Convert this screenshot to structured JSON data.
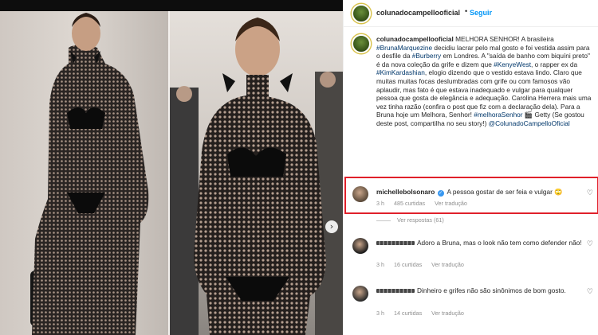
{
  "post": {
    "username": "colunadocampellooficial",
    "follow_label": "Seguir",
    "separator": "•"
  },
  "caption": {
    "username": "colunadocampellooficial",
    "segments": [
      {
        "t": "MELHORA SENHOR! A brasileira "
      },
      {
        "t": "#BrunaMarquezine",
        "tag": true
      },
      {
        "t": " decidiu lacrar pelo mal gosto e foi vestida assim para o desfile da "
      },
      {
        "t": "#Burberry",
        "tag": true
      },
      {
        "t": " em Londres. A \"saída de banho com biquíni preto\" é da nova coleção da grife e dizem que "
      },
      {
        "t": "#KenyeWest",
        "tag": true
      },
      {
        "t": ", o rapper ex da "
      },
      {
        "t": "#KimKardashian",
        "tag": true
      },
      {
        "t": ", elogio dizendo que o vestido estava lindo. Claro que muitas muitas focas deslumbradas com grife ou com famosos vão aplaudir, mas fato é que estava inadequado e vulgar para qualquer pessoa que gosta de elegância e adequação. Carolina Herrera mais uma vez tinha razão (confira o post que fiz com a declaração dela). Para a Bruna hoje um Melhora, Senhor! "
      },
      {
        "t": "#melhoraSenhor",
        "tag": true
      },
      {
        "t": " 🎬 Getty (Se gostou deste post, compartilha no seu story!) "
      },
      {
        "t": "@ColunadoCampelloOficial",
        "tag": true
      }
    ]
  },
  "comments": [
    {
      "username": "michellebolsonaro",
      "verified": true,
      "text": "A pessoa gostar de ser feia e vulgar 🙄",
      "time": "3 h",
      "likes": "485 curtidas",
      "reply": "Ver tradução",
      "avatar_color": "#5b4a3a"
    },
    {
      "username": "",
      "text": "Adoro a Bruna, mas o look não tem como defender não!",
      "time": "3 h",
      "likes": "16 curtidas",
      "reply": "Ver tradução",
      "avatar_color": "#1a1a1a"
    },
    {
      "username": "",
      "text": "Dinheiro e grifes não são sinônimos de bom gosto.",
      "time": "3 h",
      "likes": "14 curtidas",
      "reply": "Ver tradução",
      "avatar_color": "#2a2a2a"
    }
  ],
  "view_replies": "Ver respostas (61)",
  "icons": {
    "heart": "heart-icon",
    "verified": "verified-badge-icon",
    "carousel_next": "chevron-right-icon"
  },
  "colors": {
    "accent_blue": "#0095f6",
    "hashtag": "#00376b",
    "highlight_red": "#e0202a",
    "muted": "#8e8e8e"
  }
}
